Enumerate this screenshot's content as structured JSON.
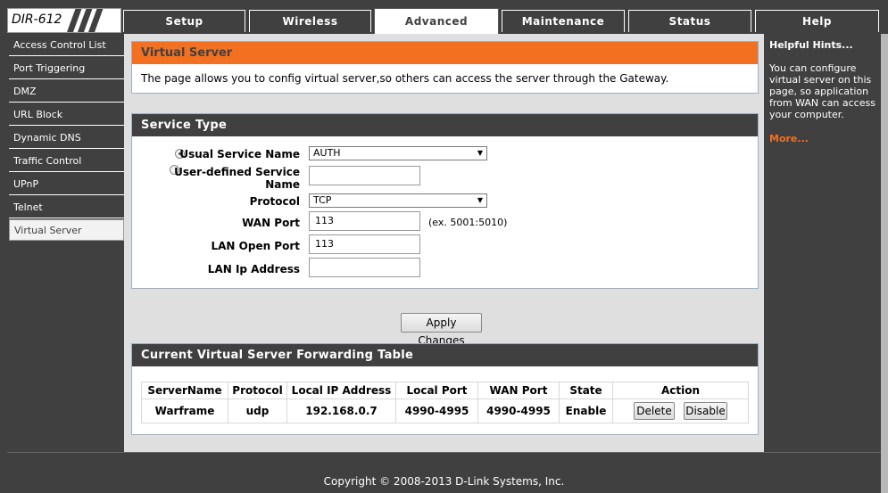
{
  "logo": {
    "text": "DIR-612"
  },
  "tabs": [
    {
      "label": "Setup"
    },
    {
      "label": "Wireless"
    },
    {
      "label": "Advanced"
    },
    {
      "label": "Maintenance"
    },
    {
      "label": "Status"
    },
    {
      "label": "Help"
    }
  ],
  "nav": [
    {
      "label": "Access Control List"
    },
    {
      "label": "Port Triggering"
    },
    {
      "label": "DMZ"
    },
    {
      "label": "URL Block"
    },
    {
      "label": "Dynamic DNS"
    },
    {
      "label": "Traffic Control"
    },
    {
      "label": "UPnP"
    },
    {
      "label": "Telnet"
    },
    {
      "label": "Virtual Server"
    }
  ],
  "virtual_server": {
    "title": "Virtual Server",
    "description": "The page allows you to config virtual server,so others can access the server through the Gateway."
  },
  "service_type": {
    "title": "Service Type",
    "usual_label": "Usual Service Name",
    "usual_value": "AUTH",
    "user_defined_label_1": "User-defined Service",
    "user_defined_label_2": "Name",
    "user_defined_value": "",
    "protocol_label": "Protocol",
    "protocol_value": "TCP",
    "wan_port_label": "WAN Port",
    "wan_port_value": "113",
    "wan_port_example": "(ex. 5001:5010)",
    "lan_open_port_label": "LAN Open Port",
    "lan_open_port_value": "113",
    "lan_ip_label": "LAN Ip Address",
    "lan_ip_value": "",
    "apply_label": "Apply Changes"
  },
  "forwarding_table": {
    "title": "Current Virtual Server Forwarding Table",
    "headers": [
      "ServerName",
      "Protocol",
      "Local IP Address",
      "Local Port",
      "WAN Port",
      "State",
      "Action"
    ],
    "rows": [
      {
        "server_name": "Warframe",
        "protocol": "udp",
        "local_ip": "192.168.0.7",
        "local_port": "4990-4995",
        "wan_port": "4990-4995",
        "state": "Enable",
        "delete_label": "Delete",
        "disable_label": "Disable"
      }
    ]
  },
  "hints": {
    "title": "Helpful Hints...",
    "text": "You can configure virtual server on this page, so application from WAN can access your computer.",
    "more": "More..."
  },
  "footer": {
    "copyright": "Copyright © 2008-2013 D-Link Systems, Inc."
  },
  "colors": {
    "accent": "#f37021",
    "dark": "#404040",
    "panel": "#dfdfdf"
  }
}
